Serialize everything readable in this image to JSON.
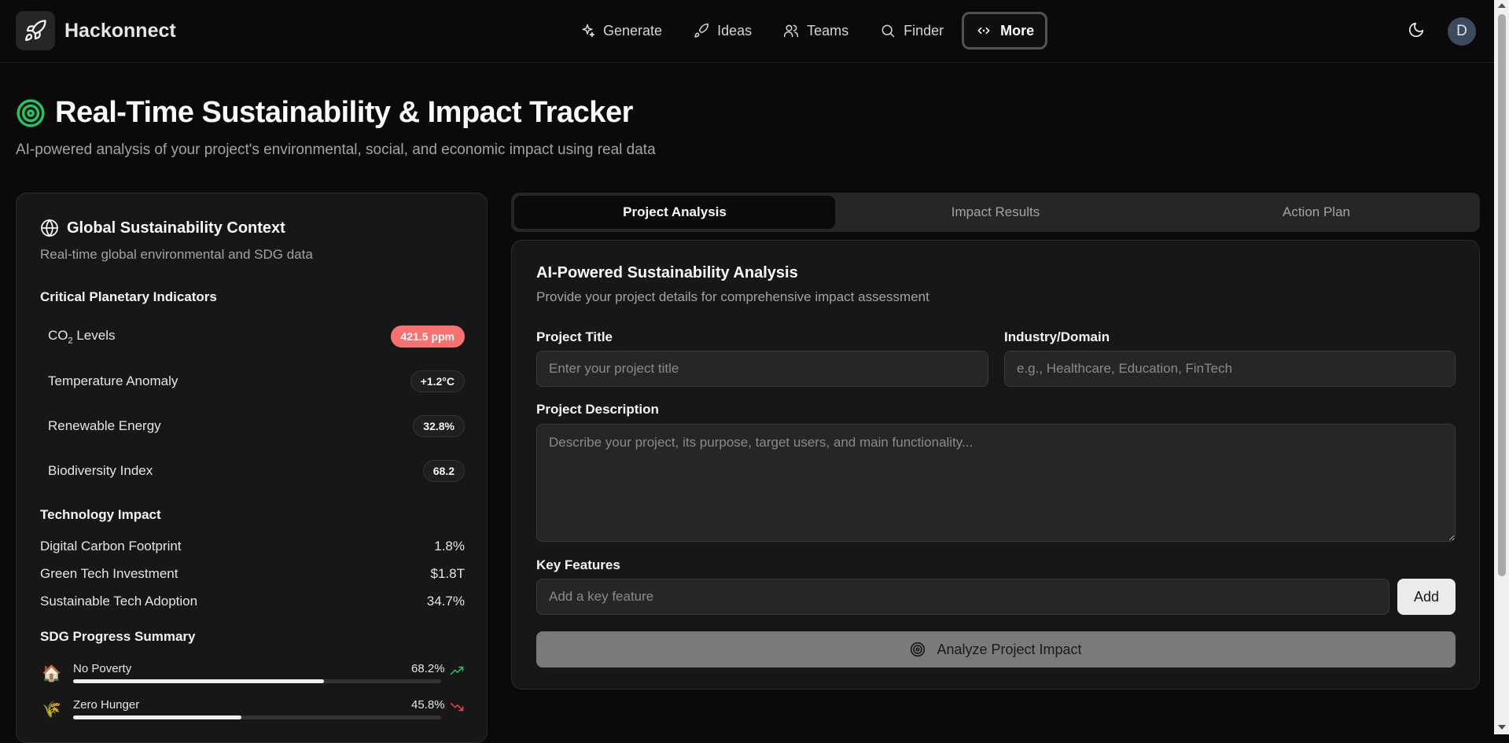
{
  "header": {
    "brand": "Hackonnect",
    "nav": [
      {
        "label": "Generate",
        "icon": "sparkles-icon"
      },
      {
        "label": "Ideas",
        "icon": "rocket-icon"
      },
      {
        "label": "Teams",
        "icon": "users-icon"
      },
      {
        "label": "Finder",
        "icon": "search-icon"
      },
      {
        "label": "More",
        "icon": "code-icon",
        "active": true
      }
    ],
    "avatar_initial": "D"
  },
  "page": {
    "title": "Real-Time Sustainability & Impact Tracker",
    "subtitle": "AI-powered analysis of your project's environmental, social, and economic impact using real data"
  },
  "left": {
    "title": "Global Sustainability Context",
    "subtitle": "Real-time global environmental and SDG data",
    "critical_label": "Critical Planetary Indicators",
    "indicators": [
      {
        "name_pre": "CO",
        "name_sub": "2",
        "name_post": " Levels",
        "value": "421.5 ppm",
        "alert": true
      },
      {
        "name": "Temperature Anomaly",
        "value": "+1.2°C"
      },
      {
        "name": "Renewable Energy",
        "value": "32.8%"
      },
      {
        "name": "Biodiversity Index",
        "value": "68.2"
      }
    ],
    "tech_label": "Technology Impact",
    "tech": [
      {
        "name": "Digital Carbon Footprint",
        "value": "1.8%"
      },
      {
        "name": "Green Tech Investment",
        "value": "$1.8T"
      },
      {
        "name": "Sustainable Tech Adoption",
        "value": "34.7%"
      }
    ],
    "sdg_label": "SDG Progress Summary",
    "sdg": [
      {
        "icon": "🏠",
        "name": "No Poverty",
        "value": "68.2%",
        "progress": 68.2,
        "trend": "up",
        "trend_color": "#22c55e"
      },
      {
        "icon": "🌾",
        "name": "Zero Hunger",
        "value": "45.8%",
        "progress": 45.8,
        "trend": "down",
        "trend_color": "#ef4444"
      }
    ]
  },
  "tabs": [
    {
      "label": "Project Analysis",
      "active": true
    },
    {
      "label": "Impact Results"
    },
    {
      "label": "Action Plan"
    }
  ],
  "form": {
    "title": "AI-Powered Sustainability Analysis",
    "subtitle": "Provide your project details for comprehensive impact assessment",
    "project_title_label": "Project Title",
    "project_title_placeholder": "Enter your project title",
    "industry_label": "Industry/Domain",
    "industry_placeholder": "e.g., Healthcare, Education, FinTech",
    "description_label": "Project Description",
    "description_placeholder": "Describe your project, its purpose, target users, and main functionality...",
    "features_label": "Key Features",
    "features_placeholder": "Add a key feature",
    "add_label": "Add",
    "analyze_label": "Analyze Project Impact"
  },
  "colors": {
    "accent_green": "#22c55e",
    "alert_red": "#f87171"
  }
}
